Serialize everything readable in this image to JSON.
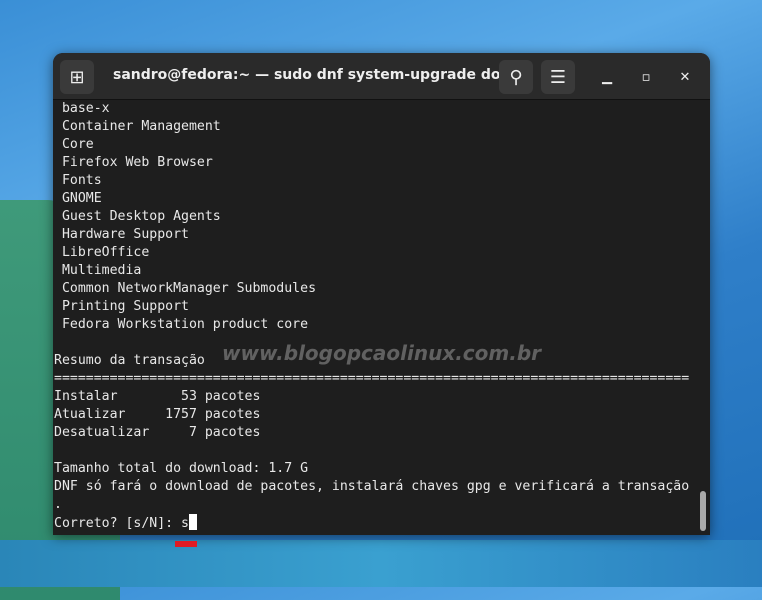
{
  "window": {
    "title": "sandro@fedora:~ — sudo dnf system-upgrade dow…",
    "icons": {
      "new_tab": "new-tab-icon",
      "search": "search-icon",
      "menu": "hamburger-menu-icon",
      "minimize": "minimize-icon",
      "maximize": "maximize-icon",
      "close": "close-icon"
    }
  },
  "terminal": {
    "lines": [
      " base-x",
      " Container Management",
      " Core",
      " Firefox Web Browser",
      " Fonts",
      " GNOME",
      " Guest Desktop Agents",
      " Hardware Support",
      " LibreOffice",
      " Multimedia",
      " Common NetworkManager Submodules",
      " Printing Support",
      " Fedora Workstation product core",
      "",
      "Resumo da transação",
      "================================================================================",
      "Instalar        53 pacotes",
      "Atualizar     1757 pacotes",
      "Desatualizar     7 pacotes",
      "",
      "Tamanho total do download: 1.7 G",
      "DNF só fará o download de pacotes, instalará chaves gpg e verificará a transação",
      "."
    ],
    "prompt": "Correto? [s/N]: s"
  },
  "watermark": "www.blogopcaolinux.com.br"
}
